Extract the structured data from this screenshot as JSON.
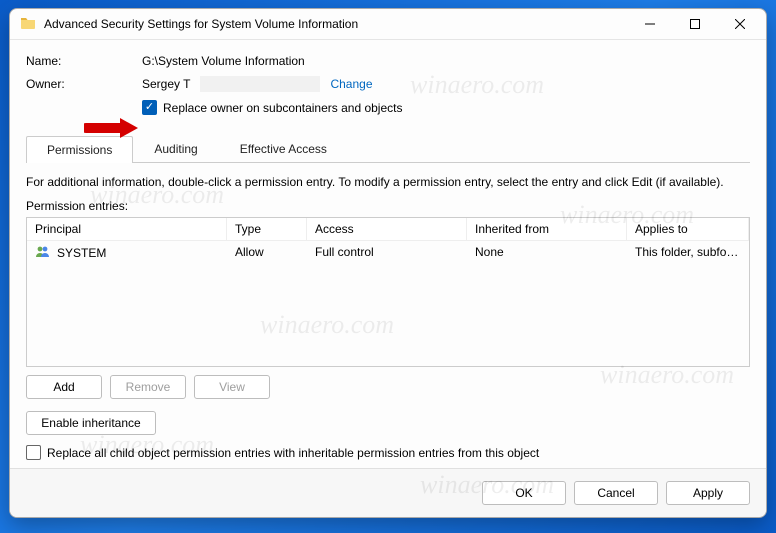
{
  "window": {
    "title": "Advanced Security Settings for System Volume Information"
  },
  "fields": {
    "name_label": "Name:",
    "name_value": "G:\\System Volume Information",
    "owner_label": "Owner:",
    "owner_value": "Sergey T",
    "change_link": "Change"
  },
  "replace_owner": {
    "label": "Replace owner on subcontainers and objects",
    "checked": true
  },
  "tabs": [
    {
      "label": "Permissions",
      "active": true
    },
    {
      "label": "Auditing",
      "active": false
    },
    {
      "label": "Effective Access",
      "active": false
    }
  ],
  "info_line": "For additional information, double-click a permission entry. To modify a permission entry, select the entry and click Edit (if available).",
  "perm_caption": "Permission entries:",
  "perm_headers": {
    "principal": "Principal",
    "type": "Type",
    "access": "Access",
    "inherited": "Inherited from",
    "applies": "Applies to"
  },
  "perm_rows": [
    {
      "principal": "SYSTEM",
      "type": "Allow",
      "access": "Full control",
      "inherited": "None",
      "applies": "This folder, subfolders and files"
    }
  ],
  "buttons": {
    "add": "Add",
    "remove": "Remove",
    "view": "View",
    "enable_inh": "Enable inheritance"
  },
  "replace_child": {
    "label": "Replace all child object permission entries with inheritable permission entries from this object",
    "checked": false
  },
  "footer": {
    "ok": "OK",
    "cancel": "Cancel",
    "apply": "Apply"
  },
  "watermark": "winaero.com"
}
